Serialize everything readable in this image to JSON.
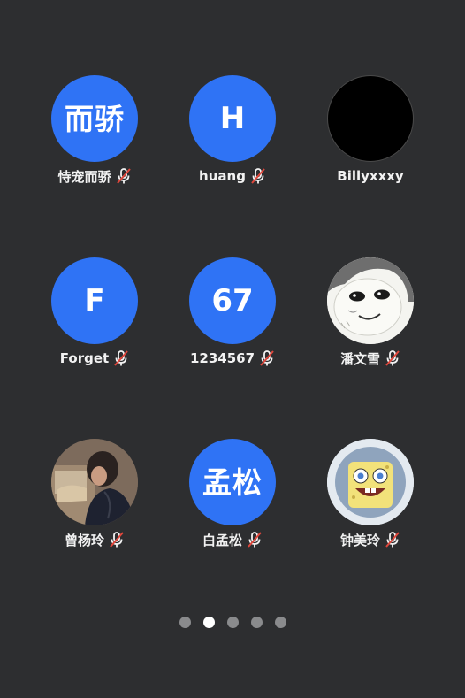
{
  "participants": [
    {
      "name": "恃宠而骄",
      "avatar_text": "而骄",
      "muted": true
    },
    {
      "name": "huang",
      "avatar_text": "H",
      "muted": true
    },
    {
      "name": "Billyxxxy",
      "avatar_text": "",
      "muted": false
    },
    {
      "name": "Forget",
      "avatar_text": "F",
      "muted": true
    },
    {
      "name": "1234567",
      "avatar_text": "67",
      "muted": true
    },
    {
      "name": "潘文雪",
      "avatar_text": "",
      "muted": true
    },
    {
      "name": "曾杨玲",
      "avatar_text": "",
      "muted": true
    },
    {
      "name": "白孟松",
      "avatar_text": "孟松",
      "muted": true
    },
    {
      "name": "钟美玲",
      "avatar_text": "",
      "muted": true
    }
  ],
  "colors": {
    "background": "#2d2e30",
    "avatar_blue": "#2f73f5",
    "mute_red": "#e0473c"
  },
  "icons": {
    "mute": "microphone-muted-icon"
  },
  "pager": {
    "total": 5,
    "current": 2
  }
}
